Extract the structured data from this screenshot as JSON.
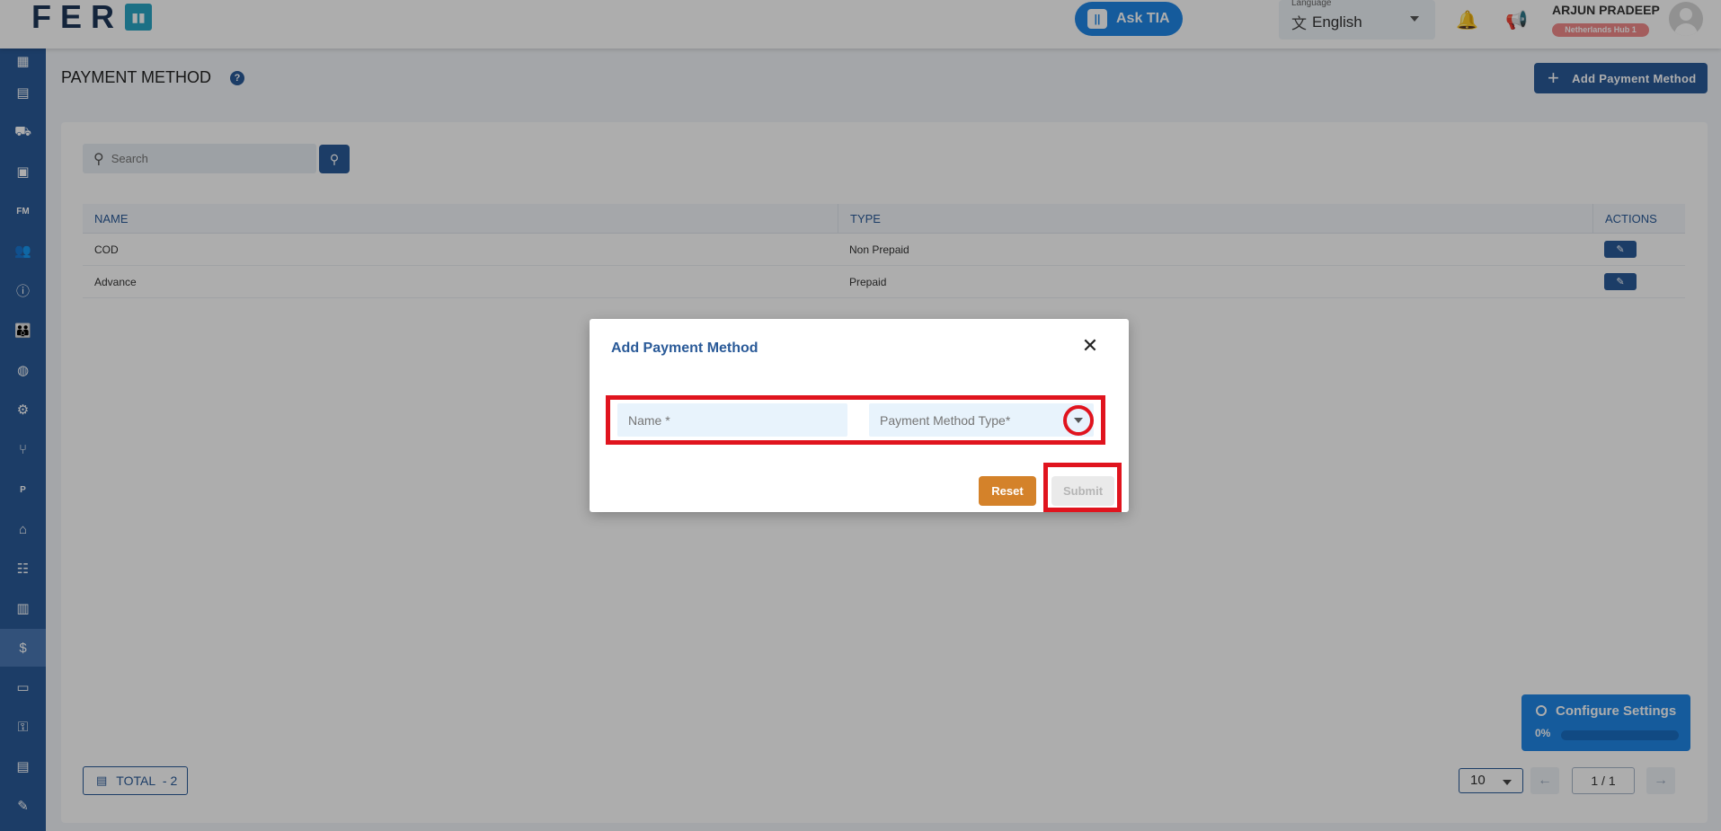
{
  "header": {
    "logo_text": "FER",
    "ask_tia_label": "Ask TIA",
    "language_label": "Language",
    "language_value": "English",
    "user_name": "ARJUN PRADEEP",
    "hub_badge": "Netherlands Hub 1"
  },
  "sidebar": {
    "items": [
      {
        "icon": "dashboard-icon"
      },
      {
        "icon": "calendar-icon"
      },
      {
        "icon": "truck-icon"
      },
      {
        "icon": "archive-icon"
      },
      {
        "icon": "fm-icon",
        "text": "FM"
      },
      {
        "icon": "users-icon"
      },
      {
        "icon": "info-icon"
      },
      {
        "icon": "group-icon"
      },
      {
        "icon": "globe-icon"
      },
      {
        "icon": "gear-icon"
      },
      {
        "icon": "branch-icon"
      },
      {
        "icon": "parking-icon",
        "text": "P"
      },
      {
        "icon": "warehouse-icon"
      },
      {
        "icon": "team-icon"
      },
      {
        "icon": "table-settings-icon"
      },
      {
        "icon": "dollar-icon",
        "text": "$",
        "active": true
      },
      {
        "icon": "id-card-icon"
      },
      {
        "icon": "key-icon"
      },
      {
        "icon": "box-icon"
      },
      {
        "icon": "edit-note-icon"
      }
    ]
  },
  "page": {
    "title": "PAYMENT METHOD",
    "add_button_label": "Add Payment Method",
    "search_placeholder": "Search"
  },
  "table": {
    "columns": [
      "NAME",
      "TYPE",
      "ACTIONS"
    ],
    "rows": [
      {
        "name": "COD",
        "type": "Non Prepaid"
      },
      {
        "name": "Advance",
        "type": "Prepaid"
      }
    ]
  },
  "footer": {
    "total_label": "TOTAL",
    "total_count": "- 2",
    "per_page": "10",
    "page_display": "1 / 1"
  },
  "config_card": {
    "title": "Configure Settings",
    "percent_label": "0%",
    "progress": 0
  },
  "modal": {
    "title": "Add Payment Method",
    "name_placeholder": "Name *",
    "type_placeholder": "Payment Method Type*",
    "reset_label": "Reset",
    "submit_label": "Submit"
  },
  "colors": {
    "primary": "#2a5a98",
    "accent": "#1f86e6",
    "reset": "#d4822a",
    "highlight": "#e0141e"
  }
}
